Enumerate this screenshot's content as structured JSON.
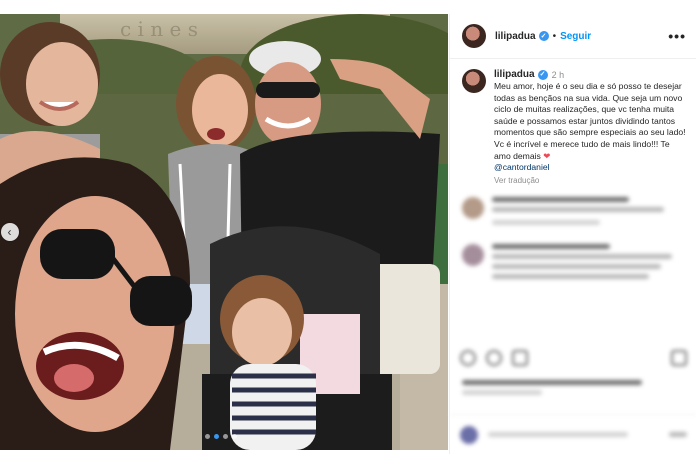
{
  "post": {
    "username": "lilipadua",
    "separator": "•",
    "follow_label": "Seguir",
    "more_glyph": "•••",
    "time": "2 h",
    "verified_glyph": "✓",
    "caption": "Meu amor, hoje é o seu dia e só posso te desejar todas as bençãos na sua vida. Que seja um novo ciclo de muitas realizações, que vc tenha muita saúde e possamos estar juntos dividindo tantos momentos que são sempre especiais ao seu lado! Vc é incrível e merece tudo de mais lindo!!! Te amo demais",
    "heart_emoji": "❤",
    "mention": "@cantordaniel",
    "translate_label": "Ver tradução"
  },
  "carousel": {
    "prev_glyph": "‹",
    "dot_count": 4,
    "active_dot": 1
  },
  "colors": {
    "accent": "#0095f6",
    "verified": "#3897f0",
    "heart": "#ed4956"
  },
  "icons": [
    "verified-badge-icon",
    "more-options-icon",
    "carousel-prev-icon",
    "heart-icon",
    "comment-icon",
    "share-icon",
    "save-icon",
    "emoji-icon"
  ]
}
